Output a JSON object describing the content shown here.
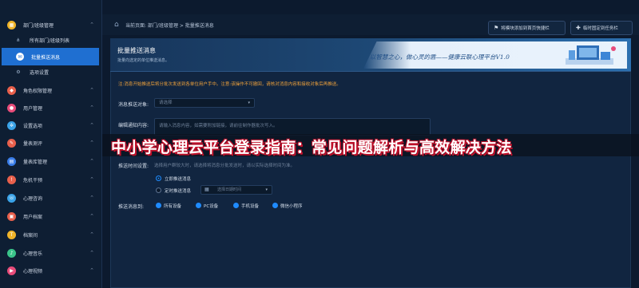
{
  "sidebar": {
    "items": [
      {
        "label": "部门/班级管理",
        "icon": "building-icon",
        "color": "#f0b429",
        "expanded": true
      },
      {
        "label": "所有部门/班级列表",
        "icon": "org-tree-icon",
        "sub": true
      },
      {
        "label": "批量推送消息",
        "icon": "message-icon",
        "sub": true,
        "active": true
      },
      {
        "label": "选项设置",
        "icon": "settings-icon",
        "sub": true
      },
      {
        "label": "角色权限管理",
        "icon": "role-icon",
        "color": "#e8604c"
      },
      {
        "label": "用户管理",
        "icon": "user-icon",
        "color": "#e84c7a"
      },
      {
        "label": "设置选项",
        "icon": "gear-icon",
        "color": "#3aa3e8"
      },
      {
        "label": "量表测评",
        "icon": "test-icon",
        "color": "#e8604c"
      },
      {
        "label": "量表库管理",
        "icon": "library-icon",
        "color": "#3a7de8"
      },
      {
        "label": "危机干预",
        "icon": "alert-icon",
        "color": "#e8604c"
      },
      {
        "label": "心理咨询",
        "icon": "chat-icon",
        "color": "#3aa3e8"
      },
      {
        "label": "用户档案",
        "icon": "file-icon",
        "color": "#e8604c"
      },
      {
        "label": "档案间",
        "icon": "archive-icon",
        "color": "#f0b429"
      },
      {
        "label": "心理音乐",
        "icon": "music-icon",
        "color": "#3ac48a"
      },
      {
        "label": "心理视频",
        "icon": "video-icon",
        "color": "#e84c7a"
      }
    ]
  },
  "header": {
    "home_icon": "home-icon",
    "breadcrumb": "当前页面: 部门/班级管理 > 批量推送消息",
    "shortcut_button": "将模块添加到首页快捷栏",
    "pin_button": "临时固定到任务栏"
  },
  "banner": {
    "title": "批量推送消息",
    "subtitle": "批量向选定的单位推送消息。",
    "slogan": "以智慧之心，做心灵的盾——健康云联心理平台V1.0"
  },
  "form": {
    "notice": "注:消息开始推送后将分批次发送到各单位用户手中。注意:该操作不可撤回，请核对消息内容和接收对象后再推送。",
    "target_label": "消息推送对象:",
    "target_placeholder": "请选择",
    "content_label": "编辑通知内容:",
    "content_placeholder": "请输入消息内容，如需要附加链接，请前往制作器批次写入。",
    "time_label": "推送时间设置:",
    "time_hint": "选择用户群较大时，请选择将消息分批发送时，请以实际选择时间为准。",
    "immediate_label": "立即推送消息",
    "scheduled_label": "定时推送消息",
    "date_placeholder": "选择日期时间",
    "channel_label": "推送消息到:",
    "channels": [
      "所有设备",
      "PC设备",
      "手机设备",
      "微信小程序"
    ]
  },
  "overlay": {
    "headline": "中小学心理云平台登录指南：常见问题解析与高效解决方法"
  }
}
